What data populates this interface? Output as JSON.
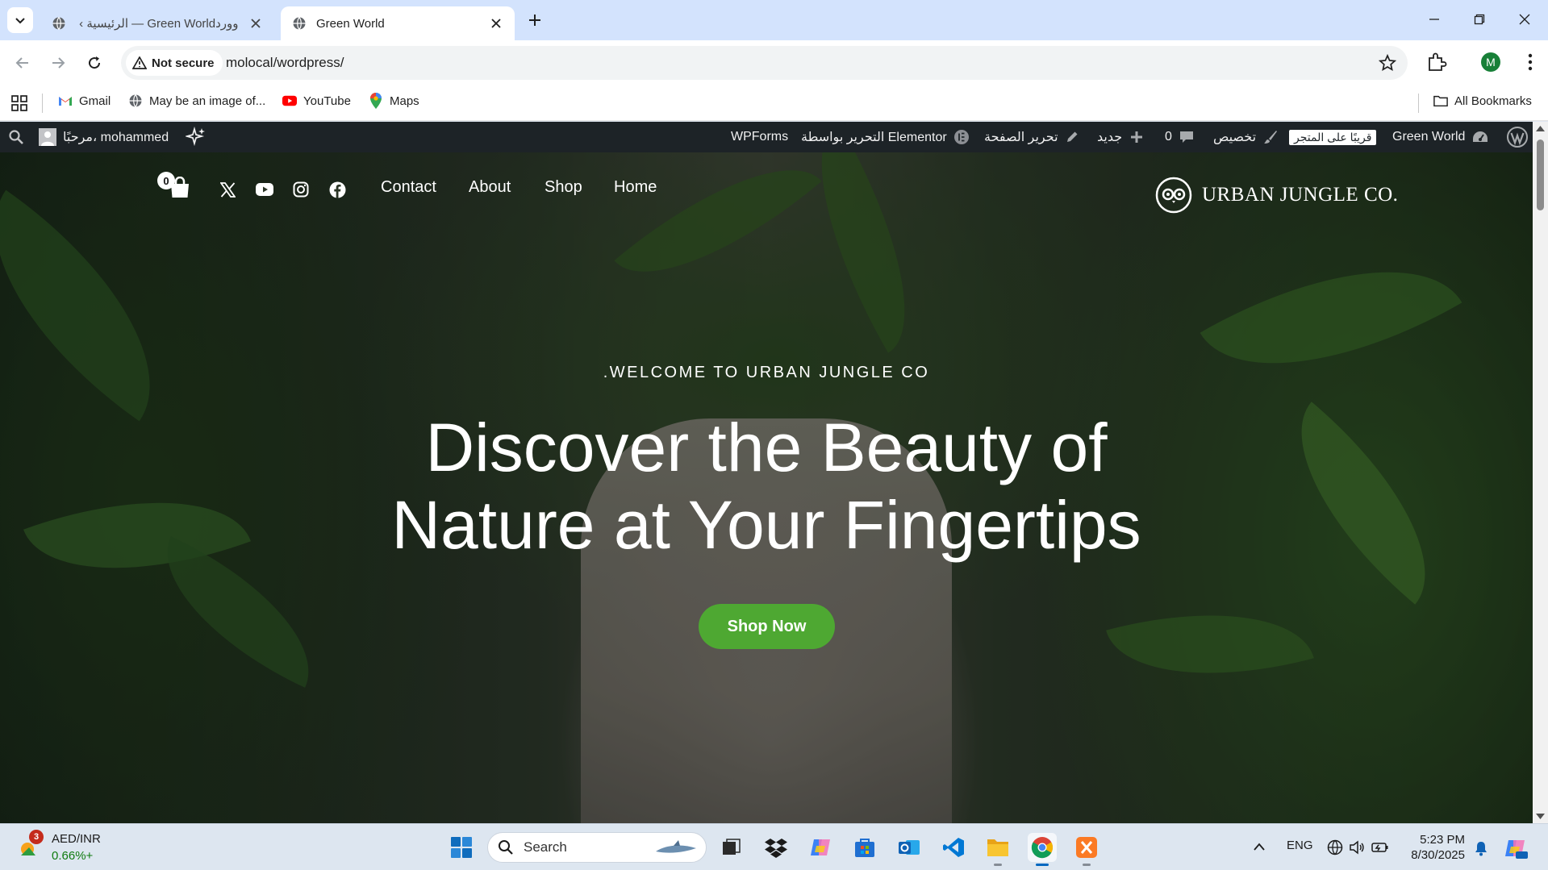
{
  "browser": {
    "tabs": [
      {
        "title": "وورد‪ ‹ الرئيسية — Green World",
        "active": false
      },
      {
        "title": "Green World",
        "active": true
      }
    ],
    "security_label": "Not secure",
    "url": "molocal/wordpress/",
    "profile_initial": "M"
  },
  "bookmarks": {
    "items": [
      {
        "label": "Gmail",
        "icon": "gmail-icon"
      },
      {
        "label": "May be an image of...",
        "icon": "globe-icon"
      },
      {
        "label": "YouTube",
        "icon": "youtube-icon"
      },
      {
        "label": "Maps",
        "icon": "maps-icon"
      }
    ],
    "all_bookmarks": "All Bookmarks"
  },
  "wp_admin_bar": {
    "site_name": "Green World",
    "coming_soon": "قريبًا على المتجر",
    "customize": "تخصيص",
    "comments_count": "0",
    "new": "جديد",
    "edit_page": "تحرير الصفحة",
    "edit_elementor": "التحرير بواسطة Elementor",
    "wpforms": "WPForms",
    "greeting": "مرحبًا، mohammed"
  },
  "site": {
    "logo_text": "URBAN JUNGLE CO.",
    "menu": [
      "Home",
      "Shop",
      "About",
      "Contact"
    ],
    "social": [
      "facebook-icon",
      "instagram-icon",
      "youtube-icon",
      "x-icon"
    ],
    "cart_count": "0",
    "hero": {
      "eyebrow": ".WELCOME TO URBAN JUNGLE CO",
      "headline_line1": "Discover the Beauty of",
      "headline_line2": "Nature at Your Fingertips",
      "cta": "Shop Now"
    }
  },
  "taskbar": {
    "widget": {
      "badge": "3",
      "title": "AED/INR",
      "value": "0.66%+"
    },
    "search_placeholder": "Search",
    "language": "ENG",
    "time": "5:23 PM",
    "date": "8/30/2025"
  },
  "colors": {
    "accent_green": "#4ea832",
    "wp_bar": "#1d2327",
    "tabstrip": "#d3e3fd"
  }
}
